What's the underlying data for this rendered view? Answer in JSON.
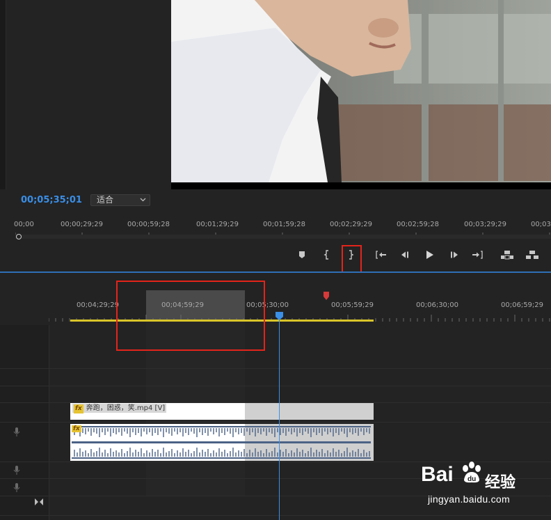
{
  "program_monitor": {
    "timecode": "00;05;35;01",
    "fit_select": {
      "value": "适合"
    },
    "ruler_labels": [
      "00;00",
      "00;00;29;29",
      "00;00;59;28",
      "00;01;29;29",
      "00;01;59;28",
      "00;02;29;29",
      "00;02;59;28",
      "00;03;29;29",
      "00;03"
    ],
    "transport_buttons": [
      {
        "name": "add-marker-button",
        "icon": "marker-icon"
      },
      {
        "name": "mark-in-button",
        "icon": "mark-in-icon"
      },
      {
        "name": "mark-out-button",
        "icon": "mark-out-icon",
        "highlighted": true
      },
      {
        "name": "go-to-in-button",
        "icon": "go-to-in-icon"
      },
      {
        "name": "step-back-button",
        "icon": "step-back-icon"
      },
      {
        "name": "play-button",
        "icon": "play-icon"
      },
      {
        "name": "step-forward-button",
        "icon": "step-forward-icon"
      },
      {
        "name": "go-to-out-button",
        "icon": "go-to-out-icon"
      },
      {
        "name": "lift-button",
        "icon": "lift-icon"
      },
      {
        "name": "extract-button",
        "icon": "extract-icon"
      }
    ]
  },
  "timeline": {
    "ruler_labels": [
      "00;04;29;29",
      "00;04;59;29",
      "00;05;30;00",
      "00;05;59;29",
      "00;06;30;00",
      "00;06;59;29"
    ],
    "video_clip": {
      "name": "奔跑，困惑，笑.mp4 [V]",
      "fx": "fx"
    },
    "audio_clip": {
      "fx": "fx"
    }
  },
  "watermark": {
    "logo": "Bai",
    "logo_tail": "经验",
    "url": "jingyan.baidu.com"
  },
  "colors": {
    "accent": "#3a8ee6",
    "highlight": "#e3241b",
    "work_area": "#d9c52a"
  }
}
